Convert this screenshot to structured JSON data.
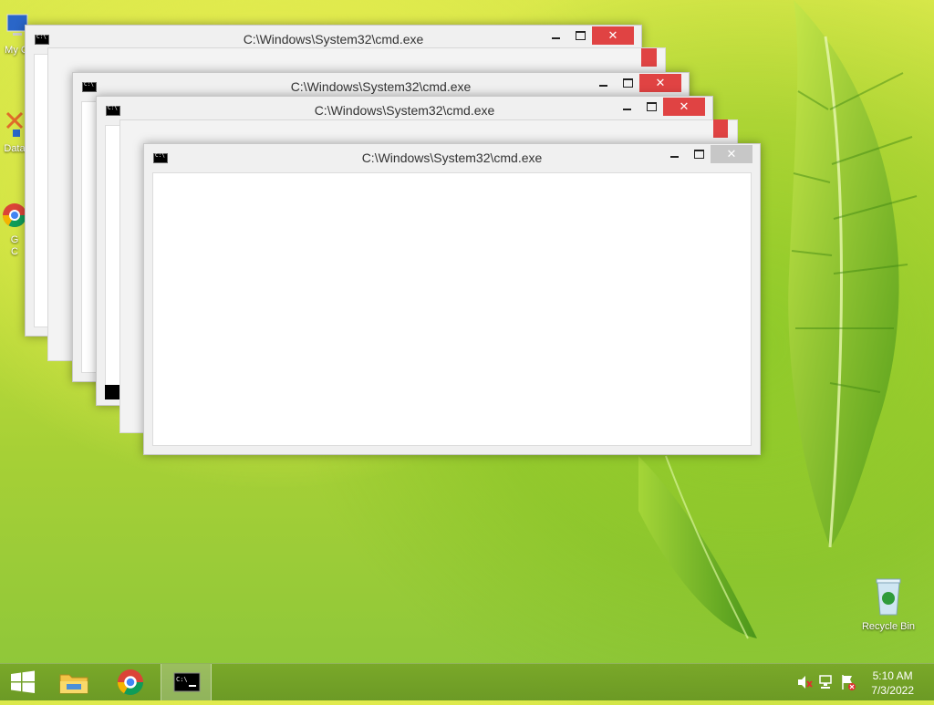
{
  "windows": [
    {
      "title": "C:\\Windows\\System32\\cmd.exe",
      "close": "✕"
    },
    {
      "title": "C:\\Windows\\System32\\cmd.exe",
      "close": "✕"
    },
    {
      "title": "C:\\Windows\\System32\\cmd.exe",
      "close": "✕"
    },
    {
      "title": "C:\\Windows\\System32\\cmd.exe",
      "close": "✕"
    }
  ],
  "desktop": {
    "icons": [
      {
        "label": "My C"
      },
      {
        "label": "Data"
      },
      {
        "label": "G\nC"
      },
      {
        "label": "Recycle Bin"
      }
    ]
  },
  "taskbar": {
    "start_icon": "windows-logo-icon",
    "pinned": [
      "file-explorer-icon",
      "chrome-icon",
      "cmd-icon"
    ],
    "tray_icons": [
      "volume-muted-icon",
      "network-icon",
      "action-center-flag-icon"
    ],
    "time": "5:10 AM",
    "date": "7/3/2022"
  },
  "colors": {
    "close_red": "#e04343",
    "taskbar": "#78a528"
  }
}
